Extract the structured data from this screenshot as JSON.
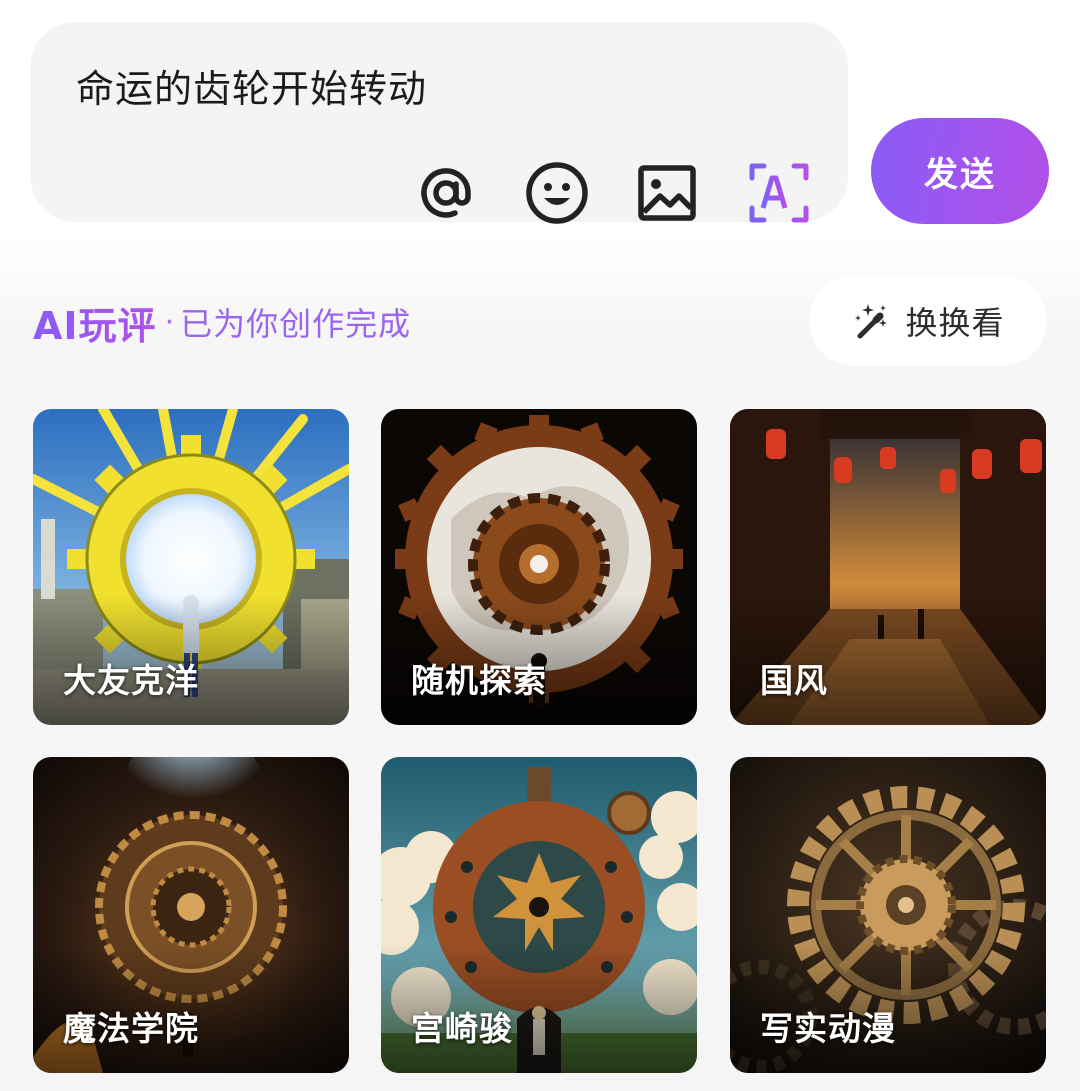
{
  "composer": {
    "input_value": "命运的齿轮开始转动",
    "tools": [
      {
        "icon": "at-icon"
      },
      {
        "icon": "emoji-icon"
      },
      {
        "icon": "image-icon"
      },
      {
        "icon": "ai-scan-icon"
      }
    ],
    "send_label": "发送"
  },
  "ai_section": {
    "brand": "AI玩评",
    "separator": "·",
    "subtitle": "已为你创作完成",
    "shuffle_icon": "magic-wand-icon",
    "shuffle_label": "换换看"
  },
  "styles": [
    {
      "label": "大友克洋"
    },
    {
      "label": "随机探索"
    },
    {
      "label": "国风"
    },
    {
      "label": "魔法学院"
    },
    {
      "label": "宫崎骏"
    },
    {
      "label": "写实动漫"
    }
  ],
  "colors": {
    "accent_start": "#8a5cf6",
    "accent_end": "#b24fe8",
    "composer_bg": "#f4f4f5"
  }
}
